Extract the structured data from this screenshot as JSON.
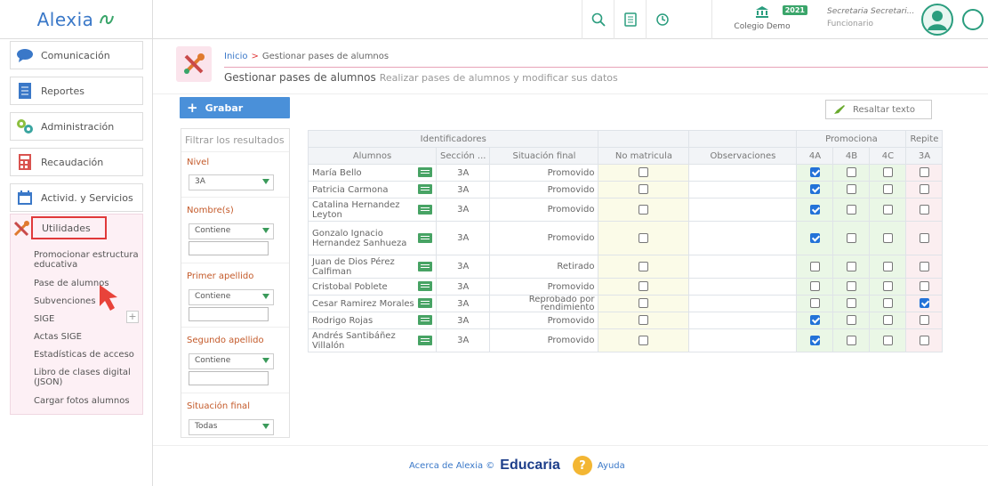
{
  "app": {
    "name": "Alexia"
  },
  "topbar": {
    "colegio": "Colegio Demo",
    "year": "2021",
    "user_name": "Secretaria Secretari...",
    "user_role": "Funcionario"
  },
  "sidebar": {
    "items": [
      {
        "label": "Comunicación",
        "icon": "chat-bubble-icon"
      },
      {
        "label": "Reportes",
        "icon": "report-icon"
      },
      {
        "label": "Administración",
        "icon": "gears-icon"
      },
      {
        "label": "Recaudación",
        "icon": "calculator-icon"
      },
      {
        "label": "Activid. y Servicios",
        "icon": "calendar-icon"
      }
    ],
    "utilidades": {
      "label": "Utilidades",
      "subitems": [
        "Promocionar estructura educativa",
        "Pase de alumnos",
        "Subvenciones",
        "SIGE",
        "Actas SIGE",
        "Estadísticas de acceso",
        "Libro de clases digital (JSON)",
        "Cargar fotos alumnos"
      ],
      "plus": "+"
    }
  },
  "breadcrumb": {
    "home": "Inicio",
    "separator": ">",
    "current": "Gestionar pases de alumnos",
    "title": "Gestionar pases de alumnos",
    "subtitle": "Realizar pases de alumnos y modificar sus datos"
  },
  "toolbar": {
    "grabar": "Grabar",
    "resaltar": "Resaltar texto"
  },
  "filters": {
    "title": "Filtrar los resultados",
    "nivel": {
      "label": "Nivel",
      "value": "3A"
    },
    "nombres": {
      "label": "Nombre(s)",
      "value": "Contiene"
    },
    "primer_apellido": {
      "label": "Primer apellido",
      "value": "Contiene"
    },
    "segundo_apellido": {
      "label": "Segundo apellido",
      "value": "Contiene"
    },
    "situacion_final": {
      "label": "Situación final",
      "value": "Todas"
    }
  },
  "table": {
    "group_headers": {
      "identificadores": "Identificadores",
      "promociona": "Promociona",
      "repite": "Repite"
    },
    "headers": {
      "alumnos": "Alumnos",
      "seccion": "Sección ...",
      "situacion": "Situación final",
      "no_matricula": "No matricula",
      "observaciones": "Observaciones",
      "p4a": "4A",
      "p4b": "4B",
      "p4c": "4C",
      "r3a": "3A"
    },
    "rows": [
      {
        "name": "María Bello",
        "seccion": "3A",
        "situacion": "Promovido",
        "no_matricula": false,
        "p4a": true,
        "p4b": false,
        "p4c": false,
        "r3a": false,
        "size": "normal"
      },
      {
        "name": "Patricia Carmona",
        "seccion": "3A",
        "situacion": "Promovido",
        "no_matricula": false,
        "p4a": true,
        "p4b": false,
        "p4c": false,
        "r3a": false,
        "size": "normal"
      },
      {
        "name": "Catalina Hernandez Leyton",
        "seccion": "3A",
        "situacion": "Promovido",
        "no_matricula": false,
        "p4a": true,
        "p4b": false,
        "p4c": false,
        "r3a": false,
        "size": "mid"
      },
      {
        "name": "Gonzalo Ignacio Hernandez Sanhueza",
        "seccion": "3A",
        "situacion": "Promovido",
        "no_matricula": false,
        "p4a": true,
        "p4b": false,
        "p4c": false,
        "r3a": false,
        "size": "tall"
      },
      {
        "name": "Juan de Dios Pérez Calfiman",
        "seccion": "3A",
        "situacion": "Retirado",
        "no_matricula": false,
        "p4a": false,
        "p4b": false,
        "p4c": false,
        "r3a": false,
        "size": "mid"
      },
      {
        "name": "Cristobal Poblete",
        "seccion": "3A",
        "situacion": "Promovido",
        "no_matricula": false,
        "p4a": false,
        "p4b": false,
        "p4c": false,
        "r3a": false,
        "size": "normal"
      },
      {
        "name": "Cesar Ramirez Morales",
        "seccion": "3A",
        "situacion": "Reprobado por rendimiento",
        "no_matricula": false,
        "p4a": false,
        "p4b": false,
        "p4c": false,
        "r3a": true,
        "size": "normal"
      },
      {
        "name": "Rodrigo Rojas",
        "seccion": "3A",
        "situacion": "Promovido",
        "no_matricula": false,
        "p4a": true,
        "p4b": false,
        "p4c": false,
        "r3a": false,
        "size": "normal"
      },
      {
        "name": "Andrés Santibáñez Villalón",
        "seccion": "3A",
        "situacion": "Promovido",
        "no_matricula": false,
        "p4a": true,
        "p4b": false,
        "p4c": false,
        "r3a": false,
        "size": "mid"
      }
    ]
  },
  "footer": {
    "about": "Acerca de Alexia ©",
    "brand": "Educaria",
    "help_icon": "?",
    "help": "Ayuda"
  },
  "colors": {
    "accent_blue": "#4a90d9",
    "accent_pink": "#e8a3b8",
    "checkbox_on": "#2372d8",
    "green": "#47a364"
  }
}
